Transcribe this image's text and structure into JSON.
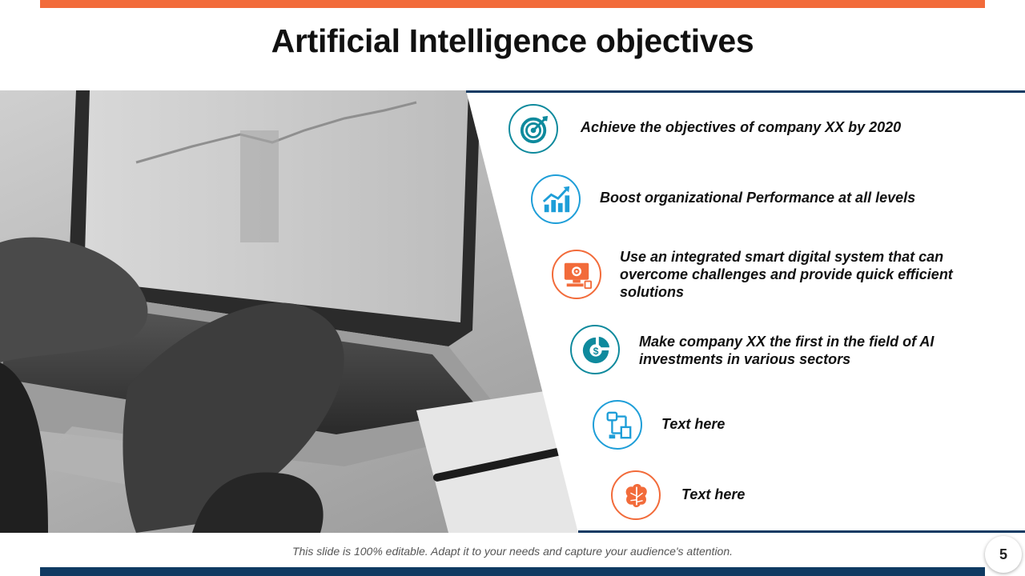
{
  "slide": {
    "title": "Artificial Intelligence objectives",
    "footer": "This slide is 100% editable. Adapt it to your needs and capture your audience's attention.",
    "page_number": "5"
  },
  "colors": {
    "accent_orange": "#f26b3a",
    "navy": "#0f3a62",
    "teal": "#0f8a9d",
    "light_blue": "#1e9ed8"
  },
  "objectives": [
    {
      "text": "Achieve the objectives of company XX by 2020",
      "icon": "target-icon",
      "color": "#0f8a9d"
    },
    {
      "text": "Boost organizational Performance at all levels",
      "icon": "growth-chart-icon",
      "color": "#1e9ed8"
    },
    {
      "text": "Use an integrated smart digital system that can overcome challenges and provide quick efficient solutions",
      "icon": "digital-system-icon",
      "color": "#f26b3a"
    },
    {
      "text": "Make company XX the first in the field of AI investments in various sectors",
      "icon": "investment-icon",
      "color": "#0f8a9d"
    },
    {
      "text": "Text here",
      "icon": "flowchart-icon",
      "color": "#1e9ed8"
    },
    {
      "text": "Text here",
      "icon": "ai-brain-icon",
      "color": "#f26b3a"
    }
  ]
}
